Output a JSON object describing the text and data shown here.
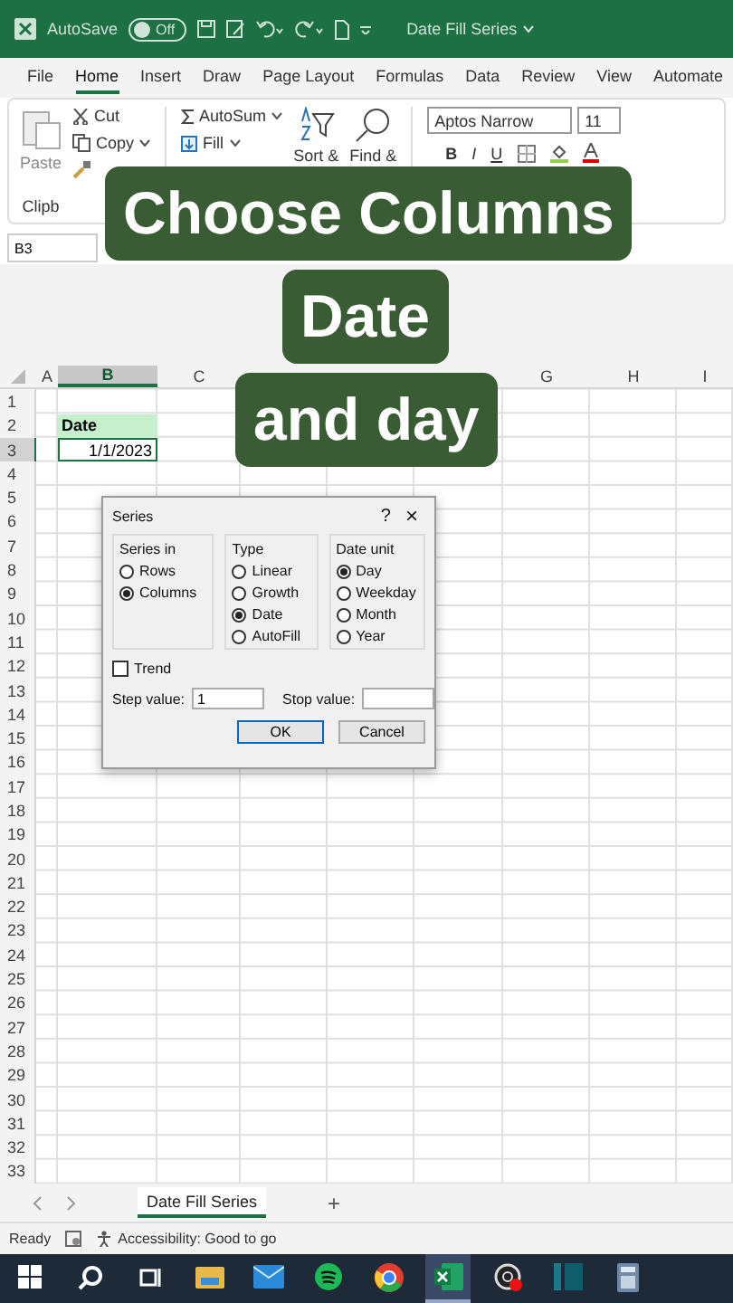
{
  "title_bar": {
    "autosave_label": "AutoSave",
    "autosave_state": "Off",
    "autosave_on": false,
    "document_title": "Date Fill Series"
  },
  "menu_tabs": [
    {
      "label": "File",
      "selected": false
    },
    {
      "label": "Home",
      "selected": true
    },
    {
      "label": "Insert",
      "selected": false
    },
    {
      "label": "Draw",
      "selected": false
    },
    {
      "label": "Page Layout",
      "selected": false
    },
    {
      "label": "Formulas",
      "selected": false
    },
    {
      "label": "Data",
      "selected": false
    },
    {
      "label": "Review",
      "selected": false
    },
    {
      "label": "View",
      "selected": false
    },
    {
      "label": "Automate",
      "selected": false
    }
  ],
  "ribbon": {
    "paste": "Paste",
    "cut": "Cut",
    "copy": "Copy",
    "clipboard_group": "Clipb",
    "autosum": "AutoSum",
    "fill": "Fill",
    "sort": "Sort &",
    "find": "Find &",
    "font_name": "Aptos Narrow",
    "font_size": "11",
    "bold": "B",
    "italic": "I",
    "underline": "U"
  },
  "name_box": "B3",
  "captions": [
    "Choose Columns",
    "Date",
    "and day"
  ],
  "columns": [
    {
      "label": "A",
      "selected": false
    },
    {
      "label": "B",
      "selected": true
    },
    {
      "label": "C",
      "selected": false
    },
    {
      "selected": false
    },
    {
      "selected": false
    },
    {
      "selected": false
    },
    {
      "label": "G",
      "selected": false
    },
    {
      "label": "H",
      "selected": false
    },
    {
      "label": "I",
      "selected": false
    }
  ],
  "rows": [
    {
      "label": "1",
      "selected": false
    },
    {
      "label": "2",
      "selected": false,
      "cells": [
        null,
        {
          "text": "Date",
          "kind": "header"
        }
      ]
    },
    {
      "label": "3",
      "selected": true,
      "cells": [
        null,
        {
          "text": "1/1/2023",
          "kind": "value"
        }
      ]
    },
    {
      "label": "4",
      "selected": false
    },
    {
      "label": "5",
      "selected": false
    },
    {
      "label": "6",
      "selected": false
    },
    {
      "label": "7",
      "selected": false
    },
    {
      "label": "8",
      "selected": false
    },
    {
      "label": "9",
      "selected": false
    },
    {
      "label": "10",
      "selected": false
    },
    {
      "label": "11",
      "selected": false
    },
    {
      "label": "12",
      "selected": false
    },
    {
      "label": "13",
      "selected": false
    },
    {
      "label": "14",
      "selected": false
    },
    {
      "label": "15",
      "selected": false
    },
    {
      "label": "16",
      "selected": false
    },
    {
      "label": "17",
      "selected": false
    },
    {
      "label": "18",
      "selected": false
    },
    {
      "label": "19",
      "selected": false
    },
    {
      "label": "20",
      "selected": false
    },
    {
      "label": "21",
      "selected": false
    },
    {
      "label": "22",
      "selected": false
    },
    {
      "label": "23",
      "selected": false
    },
    {
      "label": "24",
      "selected": false
    },
    {
      "label": "25",
      "selected": false
    },
    {
      "label": "26",
      "selected": false
    },
    {
      "label": "27",
      "selected": false
    },
    {
      "label": "28",
      "selected": false
    },
    {
      "label": "29",
      "selected": false
    },
    {
      "label": "30",
      "selected": false
    },
    {
      "label": "31",
      "selected": false
    },
    {
      "label": "32",
      "selected": false
    },
    {
      "label": "33",
      "selected": false
    }
  ],
  "dialog": {
    "title": "Series",
    "help": "?",
    "close": "×",
    "groups": [
      {
        "label": "Series in",
        "options": [
          {
            "label": "Rows",
            "selected": false
          },
          {
            "label": "Columns",
            "selected": true
          }
        ]
      },
      {
        "label": "Type",
        "options": [
          {
            "label": "Linear",
            "selected": false
          },
          {
            "label": "Growth",
            "selected": false
          },
          {
            "label": "Date",
            "selected": true
          },
          {
            "label": "AutoFill",
            "selected": false
          }
        ]
      },
      {
        "label": "Date unit",
        "options": [
          {
            "label": "Day",
            "selected": true
          },
          {
            "label": "Weekday",
            "selected": false
          },
          {
            "label": "Month",
            "selected": false
          },
          {
            "label": "Year",
            "selected": false
          }
        ]
      }
    ],
    "trend": {
      "label": "Trend",
      "checked": false
    },
    "step_value": {
      "label": "Step value:",
      "value": "1"
    },
    "stop_value": {
      "label": "Stop value:"
    },
    "buttons": [
      "OK",
      "Cancel"
    ]
  },
  "sheet_tabs": [
    {
      "label": "Date Fill Series",
      "selected": true
    }
  ],
  "add_sheet": "+",
  "status_bar": {
    "ready": "Ready",
    "accessibility": "Accessibility: Good to go"
  },
  "taskbar": [
    {
      "kind": "start",
      "selected": false
    },
    {
      "kind": "search",
      "selected": false
    },
    {
      "kind": "taskview",
      "selected": false
    },
    {
      "kind": "folder",
      "selected": false
    },
    {
      "kind": "mail",
      "selected": false
    },
    {
      "kind": "music",
      "selected": false
    },
    {
      "kind": "browser",
      "selected": false
    },
    {
      "kind": "excel",
      "selected": true
    },
    {
      "kind": "recorder",
      "selected": false
    },
    {
      "kind": "panel",
      "selected": false
    },
    {
      "kind": "calculator",
      "selected": false
    }
  ]
}
